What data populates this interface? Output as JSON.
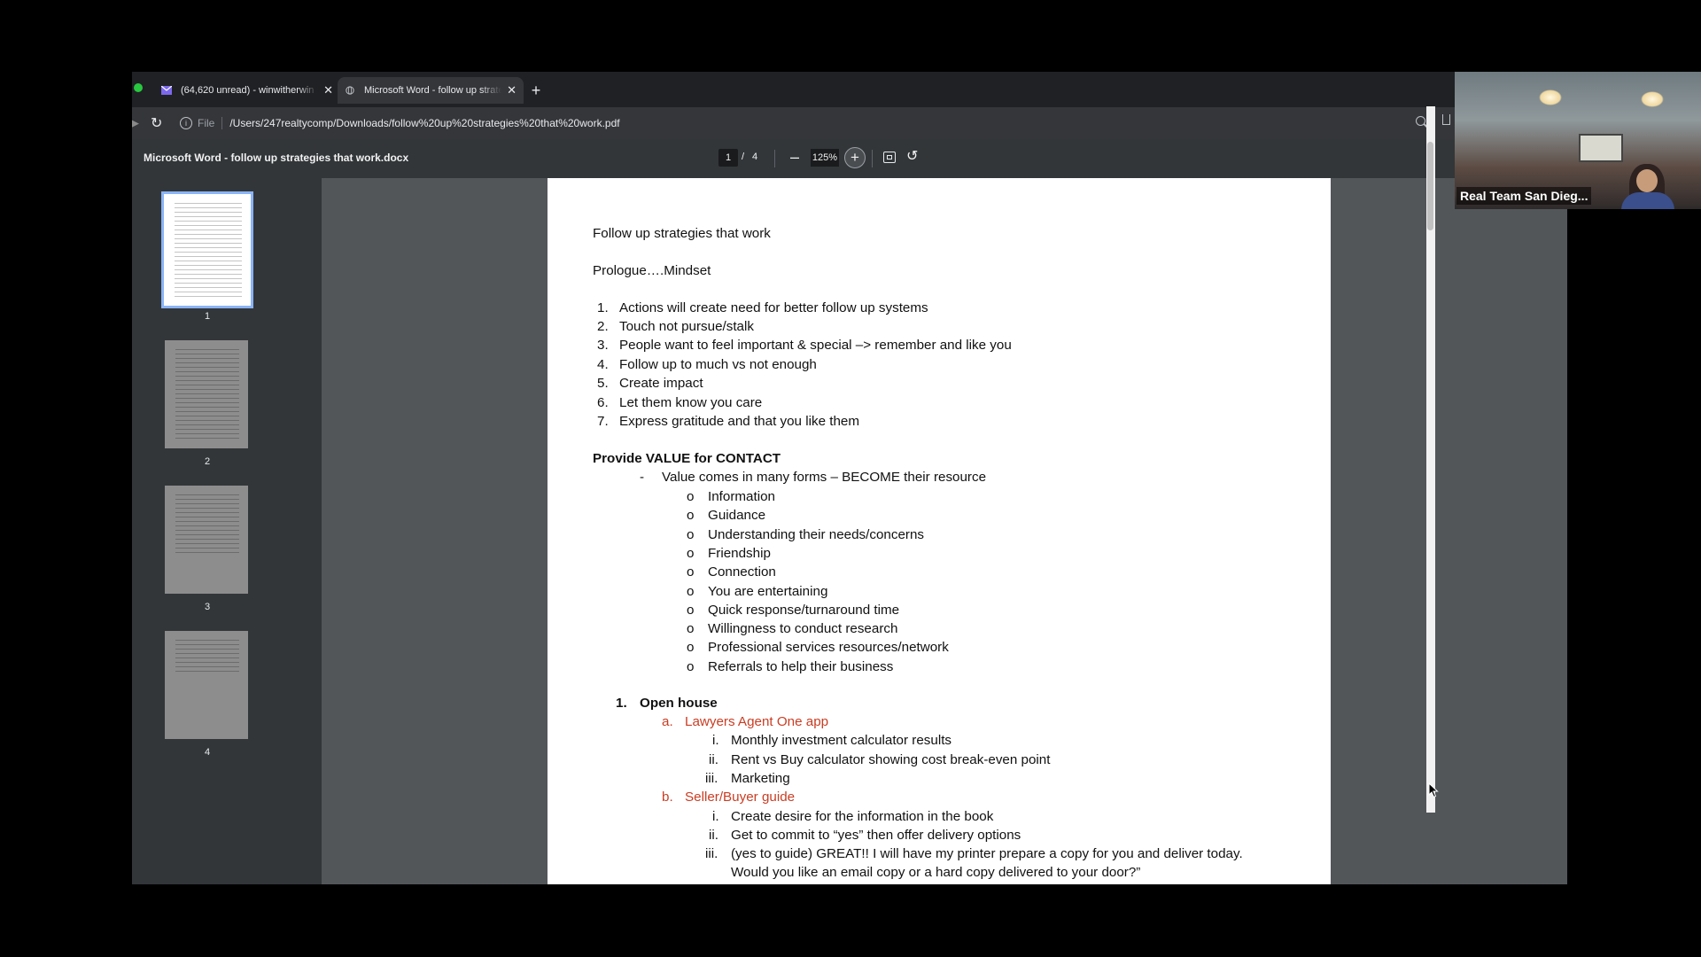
{
  "browser": {
    "tabs": [
      {
        "label": "(64,620 unread) - winwitherwin",
        "active": false
      },
      {
        "label": "Microsoft Word - follow up strategies",
        "active": true
      }
    ],
    "address": {
      "chip": "File",
      "url": "/Users/247realtycomp/Downloads/follow%20up%20strategies%20that%20work.pdf"
    }
  },
  "pdf": {
    "title": "Microsoft Word - follow up strategies that work.docx",
    "page_current": "1",
    "page_sep": "/",
    "page_total": "4",
    "zoom": "125%",
    "thumbnails": [
      "1",
      "2",
      "3",
      "4"
    ]
  },
  "document": {
    "title": "Follow up strategies that work",
    "prologue": "Prologue….Mindset",
    "mindset_items": [
      {
        "n": "1.",
        "text": "Actions will create need for better follow up systems"
      },
      {
        "n": "2.",
        "text": "Touch not pursue/stalk"
      },
      {
        "n": "3.",
        "text": "People want to feel important & special –> remember and like you"
      },
      {
        "n": "4.",
        "text": "Follow up to much vs not enough"
      },
      {
        "n": "5.",
        "text": "Create impact"
      },
      {
        "n": "6.",
        "text": "Let them know you care"
      },
      {
        "n": "7.",
        "text": "Express gratitude and that you like them"
      }
    ],
    "value_heading": "Provide VALUE for CONTACT",
    "value_dash": "-",
    "value_intro": "Value comes in many forms – BECOME their resource",
    "value_bullet": "o",
    "value_items": [
      "Information",
      "Guidance",
      "Understanding their needs/concerns",
      "Friendship",
      "Connection",
      "You are entertaining",
      "Quick response/turnaround time",
      "Willingness to conduct research",
      "Professional services resources/network",
      "Referrals to help their business"
    ],
    "section1": {
      "n": "1.",
      "title": "Open house"
    },
    "sub_a": {
      "n": "a.",
      "title": "Lawyers Agent One app",
      "items": [
        {
          "n": "i.",
          "text": "Monthly investment calculator results"
        },
        {
          "n": "ii.",
          "text": "Rent vs Buy calculator showing cost break-even point"
        },
        {
          "n": "iii.",
          "text": "Marketing"
        }
      ]
    },
    "sub_b": {
      "n": "b.",
      "title": "Seller/Buyer guide",
      "items": [
        {
          "n": "i.",
          "text": "Create desire for the information in the book"
        },
        {
          "n": "ii.",
          "text": "Get to commit to “yes” then offer delivery options"
        },
        {
          "n": "iii.",
          "text": "(yes to guide) GREAT!! I will have my printer prepare a copy for you and deliver today."
        },
        {
          "n": "",
          "text": "Would you like an email copy or a hard copy delivered to your door?”"
        }
      ]
    }
  },
  "video": {
    "name": "Real Team San Dieg..."
  },
  "colors": {
    "accent_red": "#c93d23",
    "selected_thumb_border": "#8ab4f8"
  }
}
